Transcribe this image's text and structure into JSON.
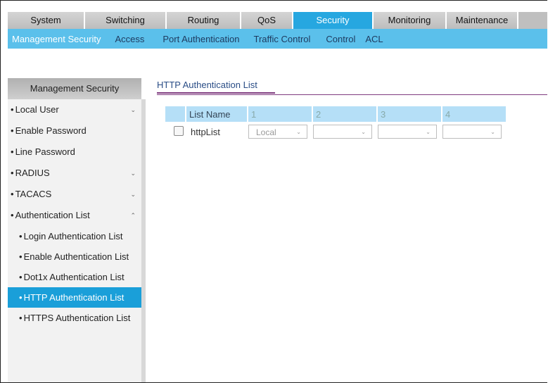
{
  "top_nav": [
    "System",
    "Switching",
    "Routing",
    "QoS",
    "Security",
    "Monitoring",
    "Maintenance"
  ],
  "active_top": "Security",
  "sub_nav": [
    "Management Security",
    "Access",
    "Port Authentication",
    "Traffic Control",
    "Control",
    "ACL"
  ],
  "active_sub": "Management Security",
  "sidebar": {
    "header": "Management Security",
    "items": [
      {
        "label": "Local User",
        "chevron": "down"
      },
      {
        "label": "Enable Password"
      },
      {
        "label": "Line Password"
      },
      {
        "label": "RADIUS",
        "chevron": "down"
      },
      {
        "label": "TACACS",
        "chevron": "down"
      },
      {
        "label": "Authentication List",
        "chevron": "up"
      },
      {
        "label": "Login Authentication List",
        "sub": true
      },
      {
        "label": "Enable Authentication List",
        "sub": true
      },
      {
        "label": "Dot1x Authentication List",
        "sub": true
      },
      {
        "label": "HTTP Authentication List",
        "sub": true,
        "active": true
      },
      {
        "label": "HTTPS Authentication List",
        "sub": true
      }
    ]
  },
  "content": {
    "title": "HTTP Authentication List",
    "table": {
      "headers": [
        "List Name",
        "1",
        "2",
        "3",
        "4"
      ],
      "rows": [
        {
          "name": "httpList",
          "methods": [
            "Local",
            "",
            "",
            ""
          ]
        }
      ]
    }
  },
  "colors": {
    "accent": "#26a7e0",
    "subnav": "#5bc0eb",
    "sidebar_active": "#1a9fd9",
    "header_cell": "#b5dff7",
    "title_text": "#2a4d86",
    "underline": "#7f3b7f"
  }
}
